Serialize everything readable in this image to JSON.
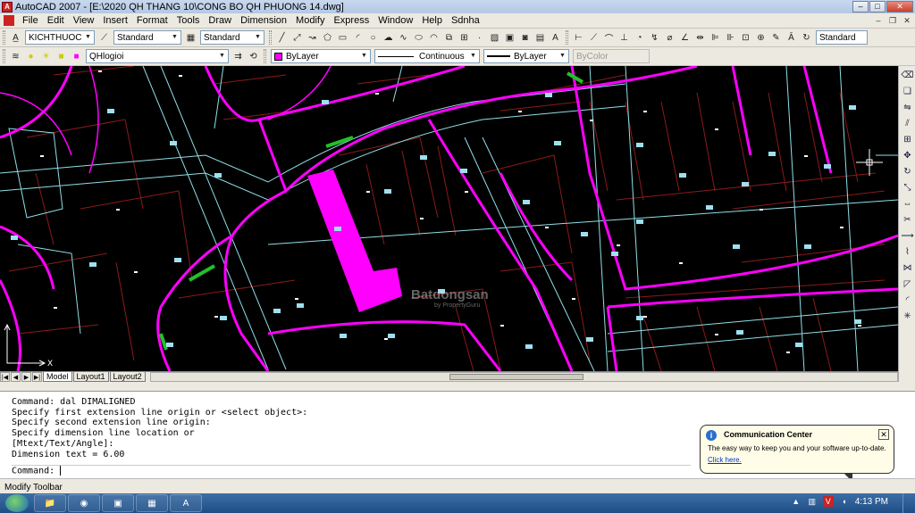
{
  "window": {
    "title": "AutoCAD 2007 - [E:\\2020 QH THANG 10\\CONG BO QH PHUONG 14.dwg]",
    "app_icon": "autocad-a-icon"
  },
  "menu": [
    "File",
    "Edit",
    "View",
    "Insert",
    "Format",
    "Tools",
    "Draw",
    "Dimension",
    "Modify",
    "Express",
    "Window",
    "Help",
    "Sdnha"
  ],
  "styles_toolbar": {
    "text_style": "KICHTHUOC",
    "dim_style": "Standard",
    "table_style": "Standard",
    "right_style": "Standard"
  },
  "layers_toolbar": {
    "layer": "QHlogioi",
    "color": "ByLayer",
    "linetype": "Continuous",
    "lineweight": "ByLayer",
    "plotstyle": "ByColor",
    "layer_color": "#ff00ff"
  },
  "canvas": {
    "watermark_title": "Batdongsan",
    "watermark_sub": "by PropertyGuru",
    "ucs_x": "X"
  },
  "tabs": [
    "Model",
    "Layout1",
    "Layout2"
  ],
  "command_lines": [
    "Command: dal DIMALIGNED",
    "Specify first extension line origin or <select object>:",
    "Specify second extension line origin:",
    "Specify dimension line location or",
    "[Mtext/Text/Angle]:",
    "Dimension text = 6.00"
  ],
  "command_prompt": "Command:",
  "status_text": "Modify Toolbar",
  "balloon": {
    "title": "Communication Center",
    "text": "The easy way to keep you and your software up-to-date.",
    "link": "Click here."
  },
  "clock": "4:13 PM",
  "colors": {
    "canvas_bg": "#000000",
    "boundary": "#ff00ff",
    "parcel": "#8b1a1a",
    "road": "#8fe0e8",
    "highlight": "#ff00ff"
  }
}
